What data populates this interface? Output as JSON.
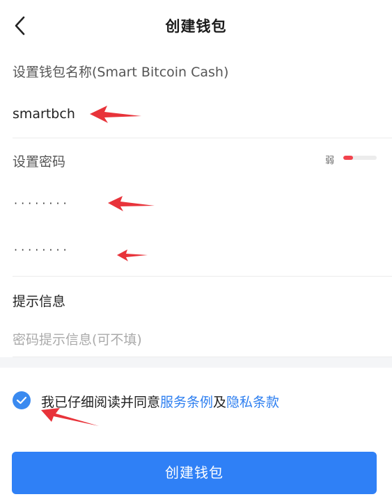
{
  "header": {
    "title": "创建钱包",
    "back_icon": "chevron-left-icon"
  },
  "wallet_name": {
    "label": "设置钱包名称(Smart Bitcoin Cash)",
    "value": "smartbch"
  },
  "password": {
    "label": "设置密码",
    "strength_label": "弱",
    "strength_level": 0.3,
    "password_mask": "········",
    "confirm_mask": "········"
  },
  "hint": {
    "label": "提示信息",
    "placeholder": "密码提示信息(可不填)"
  },
  "agreement": {
    "checked": true,
    "prefix": "我已仔细阅读并同意",
    "terms_link": "服务条例",
    "conjunction": "及",
    "privacy_link": "隐私条款"
  },
  "submit": {
    "label": "创建钱包"
  },
  "colors": {
    "primary": "#2f80f6",
    "link": "#2e7ff0",
    "strength_weak": "#f2434d",
    "annotation_arrow": "#e8333a"
  }
}
